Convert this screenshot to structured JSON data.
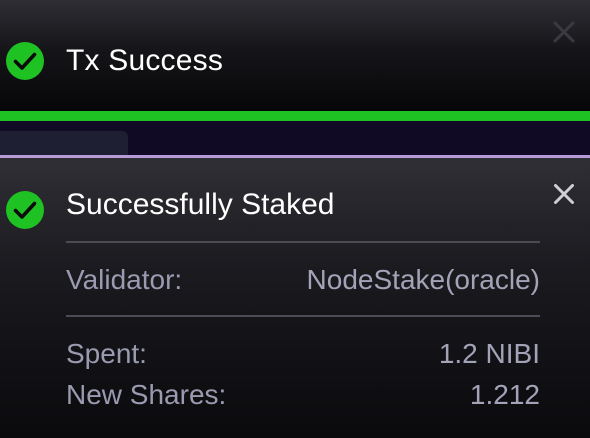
{
  "tx_toast": {
    "title": "Tx Success",
    "progress": 1.0,
    "icons": {
      "status": "check-circle-icon",
      "close": "close-icon"
    }
  },
  "stake_toast": {
    "title": "Successfully Staked",
    "validator_label": "Validator:",
    "validator_value": "NodeStake(oracle)",
    "spent_label": "Spent:",
    "spent_value": "1.2 NIBI",
    "shares_label": "New Shares:",
    "shares_value": "1.212",
    "icons": {
      "status": "check-circle-icon",
      "close": "close-icon"
    }
  },
  "colors": {
    "success_green": "#1fc223",
    "accent_purple": "#b79ad8",
    "text_primary": "#ffffff",
    "text_muted": "#9a9ab0"
  }
}
